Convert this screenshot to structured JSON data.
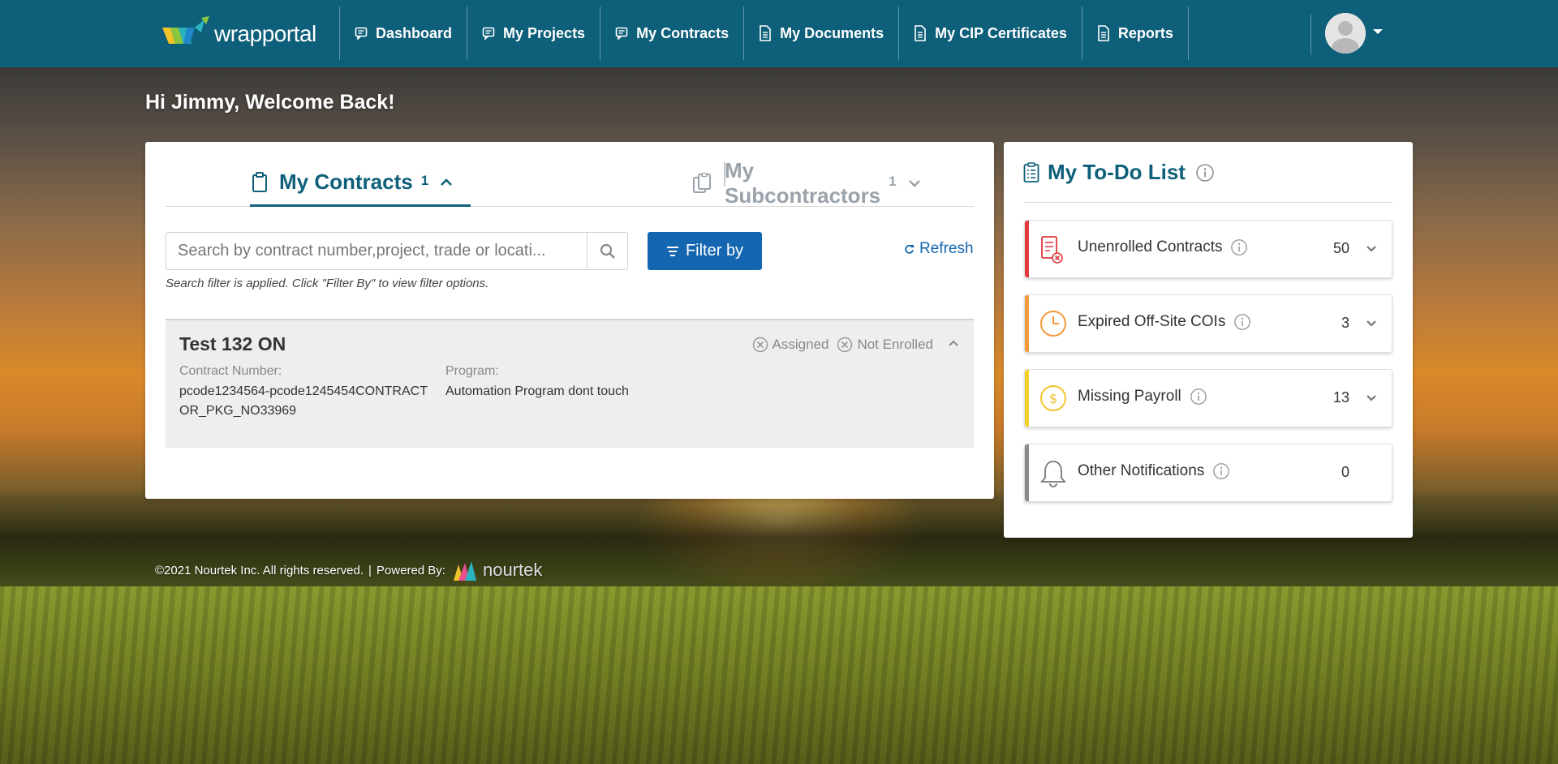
{
  "header": {
    "logo_text": "wrapportal",
    "nav": [
      {
        "label": "Dashboard",
        "icon": "chat-icon"
      },
      {
        "label": "My Projects",
        "icon": "chat-icon"
      },
      {
        "label": "My Contracts",
        "icon": "chat-icon"
      },
      {
        "label": "My Documents",
        "icon": "document-icon"
      },
      {
        "label": "My CIP Certificates",
        "icon": "document-icon"
      },
      {
        "label": "Reports",
        "icon": "document-icon"
      }
    ],
    "avatar_icon": "user-avatar-icon",
    "colors": {
      "bar": "#0e5f7a"
    }
  },
  "welcome": "Hi Jimmy, Welcome Back!",
  "contracts": {
    "tabs": [
      {
        "label": "My Contracts",
        "count": "1",
        "active": true
      },
      {
        "label": "My Subcontractors",
        "count": "1",
        "active": false
      }
    ],
    "search": {
      "placeholder": "Search by contract number,project, trade or locati..."
    },
    "filter_label": "Filter by",
    "refresh_label": "Refresh",
    "note": "Search filter is applied. Click \"Filter By\" to view filter options.",
    "card": {
      "title": "Test 132 ON",
      "status": [
        "Assigned",
        "Not Enrolled"
      ],
      "contract_label": "Contract Number:",
      "contract_value": "pcode1234564-pcode1245454CONTRACTOR_PKG_NO33969",
      "program_label": "Program:",
      "program_value": "Automation Program dont touch"
    }
  },
  "todo": {
    "title": "My To-Do List",
    "items": [
      {
        "label": "Unenrolled Contracts",
        "count": "50",
        "color": "#e0393e",
        "icon": "contract-x-icon",
        "expandable": true
      },
      {
        "label": "Expired Off-Site COIs",
        "count": "3",
        "color": "#f59a3b",
        "icon": "clock-icon",
        "expandable": true
      },
      {
        "label": "Missing Payroll",
        "count": "13",
        "color": "#f2d22a",
        "icon": "dollar-icon",
        "expandable": true
      },
      {
        "label": "Other Notifications",
        "count": "0",
        "color": "#8a8a8a",
        "icon": "bell-icon",
        "expandable": false
      }
    ]
  },
  "footer": {
    "copyright": "©2021 Nourtek Inc. All rights reserved.",
    "separator": "|",
    "powered": "Powered By:",
    "brand": "nourtek"
  }
}
